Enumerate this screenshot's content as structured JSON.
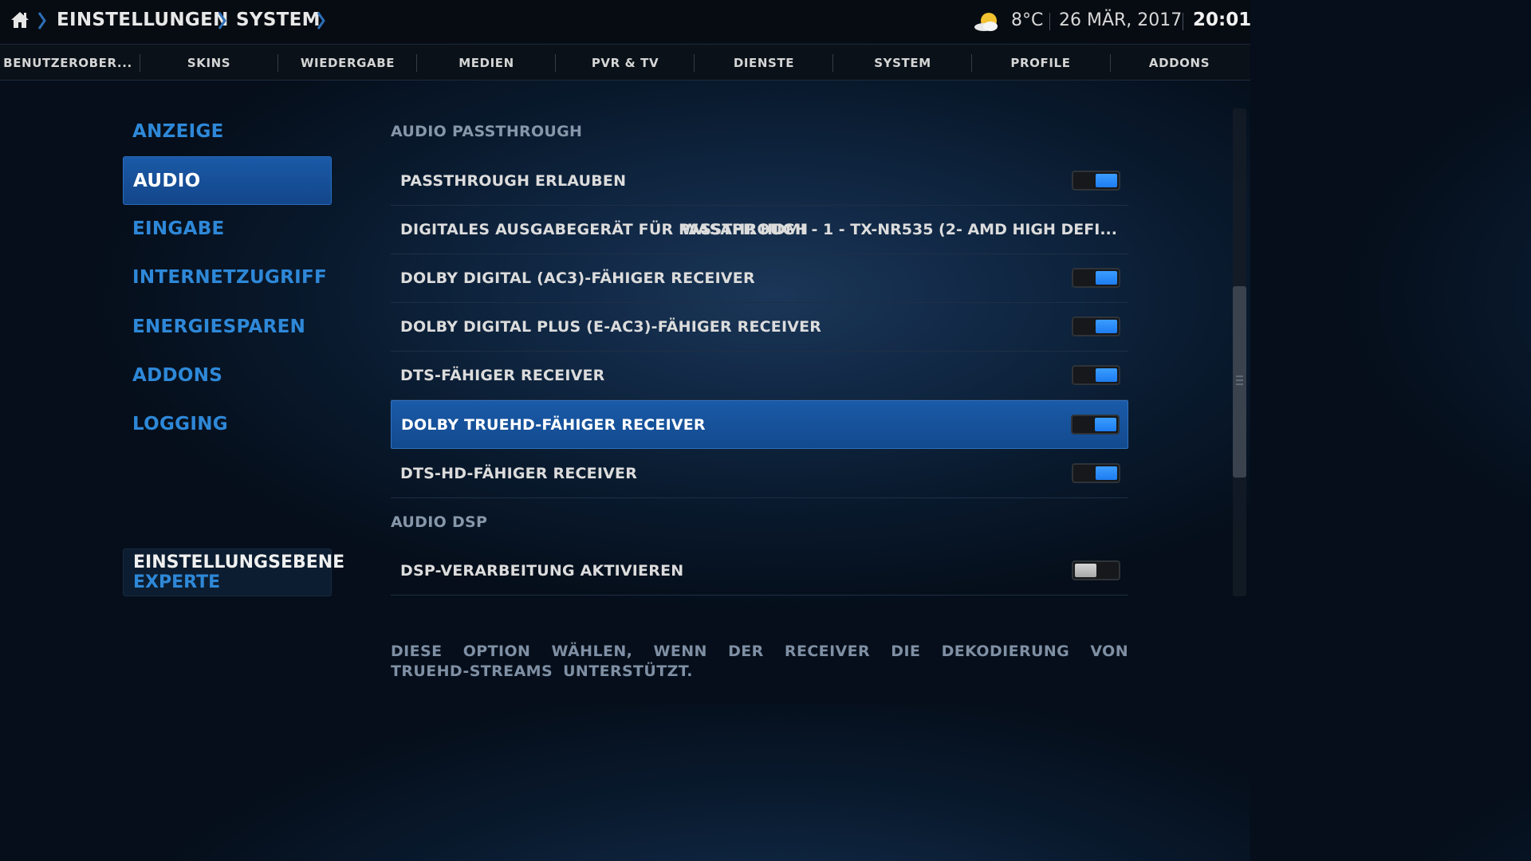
{
  "header": {
    "breadcrumb": [
      "EINSTELLUNGEN",
      "SYSTEM"
    ],
    "temperature": "8°C",
    "date": "26 MÄR, 2017",
    "time": "20:01",
    "icons": {
      "home": "home-icon",
      "weather": "partly-cloudy-icon"
    }
  },
  "tabs": [
    "BENUTZEROBER...",
    "SKINS",
    "WIEDERGABE",
    "MEDIEN",
    "PVR & TV",
    "DIENSTE",
    "SYSTEM",
    "PROFILE",
    "ADDONS"
  ],
  "left_menu": {
    "items": [
      "ANZEIGE",
      "AUDIO",
      "EINGABE",
      "INTERNETZUGRIFF",
      "ENERGIESPAREN",
      "ADDONS",
      "LOGGING"
    ],
    "selected": "AUDIO"
  },
  "settings_level": {
    "title": "EINSTELLUNGSEBENE",
    "value": "EXPERTE"
  },
  "sections": [
    {
      "title": "AUDIO PASSTHROUGH",
      "rows": [
        {
          "label": "PASSTHROUGH ERLAUBEN",
          "type": "toggle",
          "value": true
        },
        {
          "label": "DIGITALES AUSGABEGERÄT FÜR PASSTHROUGH",
          "type": "value",
          "value": "WASAPI: HDMI - 1 - TX-NR535 (2- AMD HIGH DEFI..."
        },
        {
          "label": "DOLBY DIGITAL (AC3)-FÄHIGER RECEIVER",
          "type": "toggle",
          "value": true
        },
        {
          "label": "DOLBY DIGITAL PLUS (E-AC3)-FÄHIGER RECEIVER",
          "type": "toggle",
          "value": true
        },
        {
          "label": "DTS-FÄHIGER RECEIVER",
          "type": "toggle",
          "value": true
        },
        {
          "label": "DOLBY TRUEHD-FÄHIGER RECEIVER",
          "type": "toggle",
          "value": true,
          "focused": true
        },
        {
          "label": "DTS-HD-FÄHIGER RECEIVER",
          "type": "toggle",
          "value": true
        }
      ]
    },
    {
      "title": "AUDIO DSP",
      "rows": [
        {
          "label": "DSP-VERARBEITUNG AKTIVIEREN",
          "type": "toggle",
          "value": false
        }
      ]
    }
  ],
  "description": "DIESE OPTION WÄHLEN, WENN DER RECEIVER DIE DEKODIERUNG VON TRUEHD-STREAMS UNTERSTÜTZT.",
  "scrollbar": {
    "position": 0.6
  },
  "colors": {
    "accent": "#2e88d8",
    "focus": "#1a5aa8",
    "toggle_on": "#2a8cff"
  }
}
